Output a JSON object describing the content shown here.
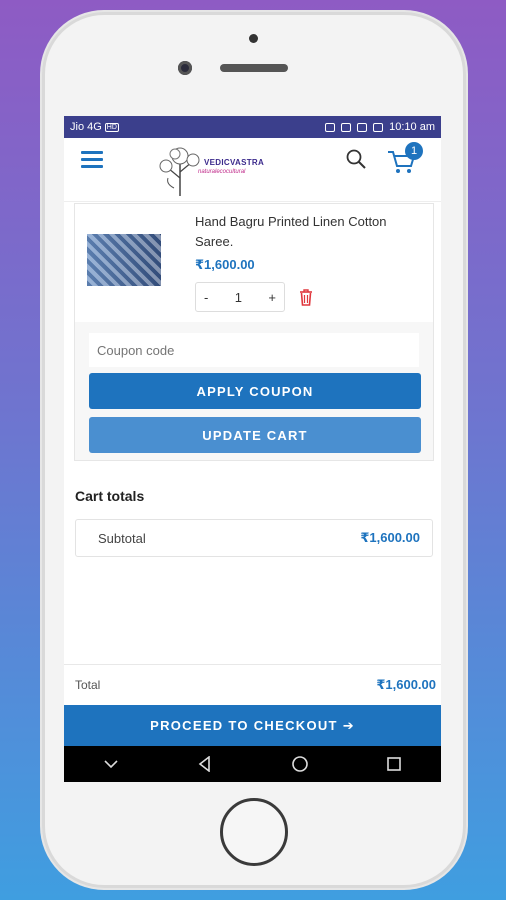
{
  "status_bar": {
    "carrier": "Jio 4G",
    "network_badge": "HD",
    "battery": "99",
    "time": "10:10 am"
  },
  "header": {
    "logo_text": "VEDICVASTRA",
    "logo_subtext": "naturalecocultural",
    "cart_count": "1"
  },
  "cart": {
    "item": {
      "name": "Hand Bagru Printed Linen Cotton Saree.",
      "price": "₹1,600.00",
      "quantity": "1",
      "minus_label": "-",
      "plus_label": "+"
    },
    "coupon_placeholder": "Coupon code",
    "apply_coupon_label": "APPLY COUPON",
    "update_cart_label": "UPDATE CART"
  },
  "totals": {
    "title": "Cart totals",
    "subtotal_label": "Subtotal",
    "subtotal_value": "₹1,600.00",
    "total_label": "Total",
    "total_value": "₹1,600.00"
  },
  "checkout": {
    "label": "PROCEED TO CHECKOUT ➔"
  },
  "colors": {
    "accent": "#1e73be",
    "status_bar": "#3b3f8c",
    "delete": "#e0383e"
  }
}
